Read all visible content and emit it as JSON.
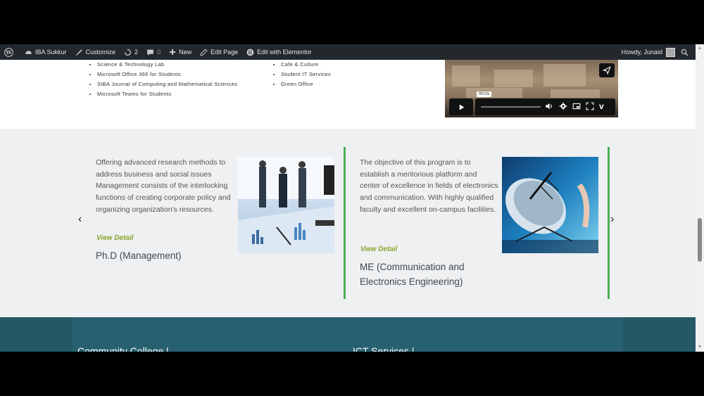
{
  "adminbar": {
    "site_name": "IBA Sukkur",
    "customize": "Customize",
    "updates_count": "2",
    "comments_count": "0",
    "new_label": "New",
    "edit_page": "Edit Page",
    "edit_elementor": "Edit with Elementor",
    "howdy": "Howdy, Junaid"
  },
  "links": {
    "column1": [
      "Science & Technology Lab",
      "Microsoft Office 365 for Students",
      "SIBA Journal of Computing and Mathematical Sciences",
      "Microsoft Teams for Students"
    ],
    "column2": [
      "Cafe & Culture",
      "Student IT Services",
      "Green Office"
    ]
  },
  "video": {
    "time_tooltip": "00:01",
    "progress": 0.0
  },
  "programs": [
    {
      "description": "Offering advanced research methods to address business and social issues Management consists of the interlocking functions of creating corporate policy and organizing organization's resources.",
      "link": "View Detail",
      "title": "Ph.D (Management)"
    },
    {
      "description": "The objective of this program is to establish a meritorious platform and center of excellence in fields of electronics and communication. With highly qualified faculty and excellent on-campus facilities.",
      "link": "View Detail",
      "title": "ME (Communication and Electronics Engineering)"
    }
  ],
  "footer": {
    "col1_heading": "Community College |",
    "col2_heading": "ICT Services |"
  },
  "colors": {
    "admin_bar": "#23282d",
    "accent_green": "#4caf50",
    "link_green": "#8aa42a",
    "footer_teal": "#245866"
  }
}
